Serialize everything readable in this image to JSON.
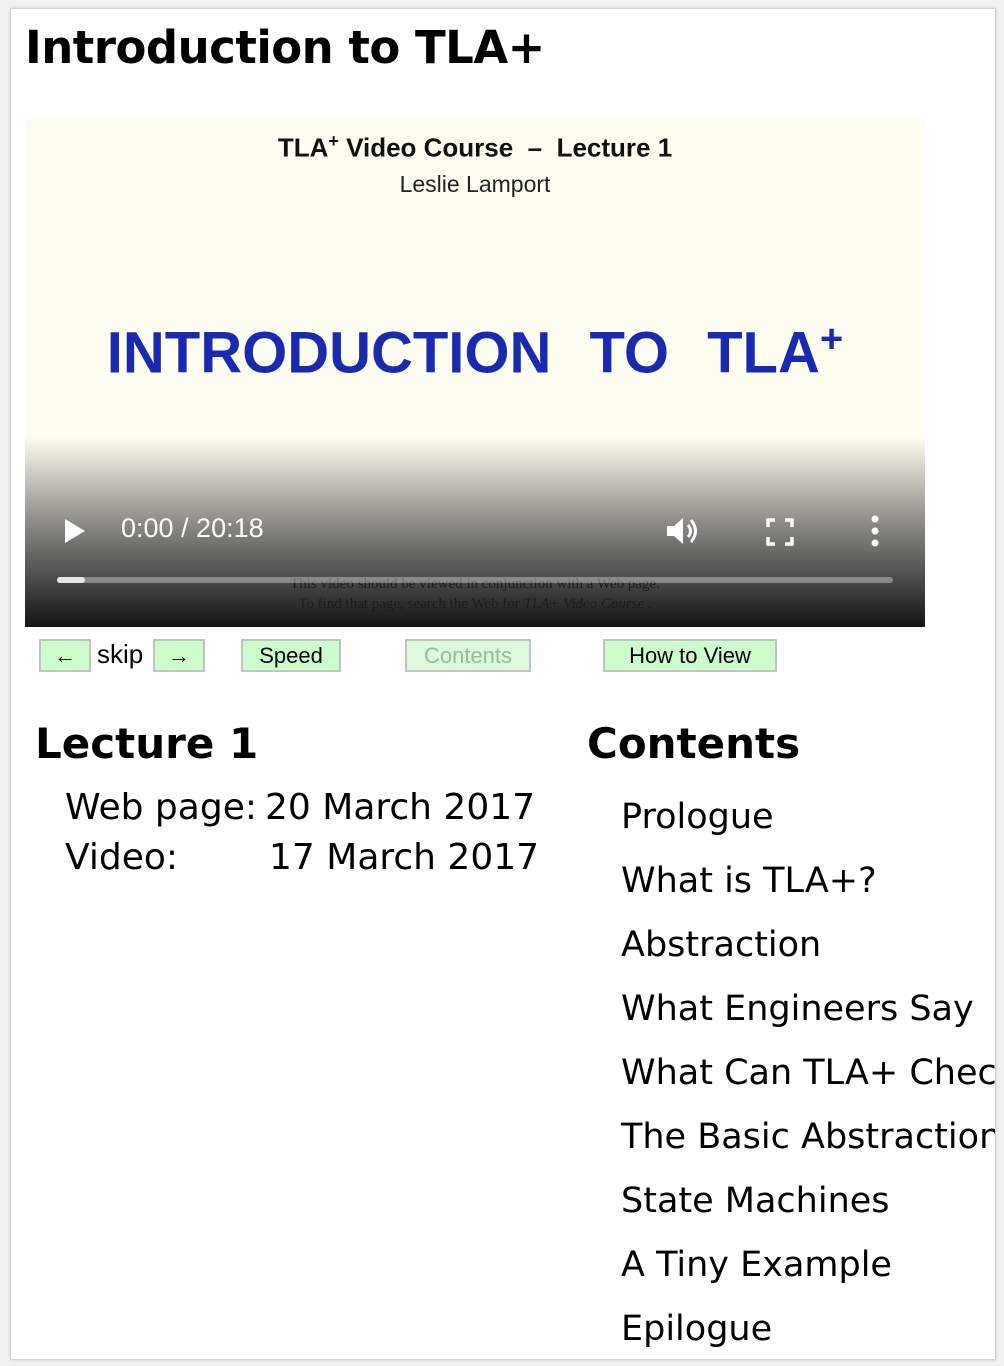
{
  "page": {
    "title": "Introduction to TLA+"
  },
  "video": {
    "course_prefix": "TLA",
    "course_sup": "+",
    "course_suffix": " Video Course  –  Lecture 1",
    "author": "Leslie Lamport",
    "headline": "INTRODUCTION TO TLA",
    "headline_sup": "+",
    "note_line1": "This video should be viewed in conjunction with a Web page.",
    "note_line2_prefix": "To find that page, search the Web for ",
    "note_line2_italic": "TLA+ Video Course",
    "note_line2_suffix": " .",
    "time": "0:00 / 20:18",
    "progress": 0.0,
    "icons": {
      "play": "play-icon",
      "volume": "volume-icon",
      "fullscreen": "fullscreen-icon",
      "more": "more-vertical-icon"
    }
  },
  "nav": {
    "prev_label": "←",
    "skip_label": "skip",
    "next_label": "→",
    "speed_label": "Speed",
    "contents_label": "Contents",
    "howto_label": "How to View"
  },
  "lecture": {
    "title": "Lecture 1",
    "web_page_label": "Web page:",
    "web_page_date": "20 March 2017",
    "video_label": "Video:",
    "video_date": "17 March 2017"
  },
  "contents": {
    "title": "Contents",
    "items": [
      "Prologue",
      "What is TLA+?",
      "Abstraction",
      "What Engineers Say",
      "What Can TLA+ Check?",
      "The Basic Abstraction",
      "State Machines",
      "A Tiny Example",
      "Epilogue"
    ]
  },
  "colors": {
    "button_bg": "#ccffcc",
    "slide_bg": "#fefdf1",
    "headline": "#1a2ab0"
  }
}
